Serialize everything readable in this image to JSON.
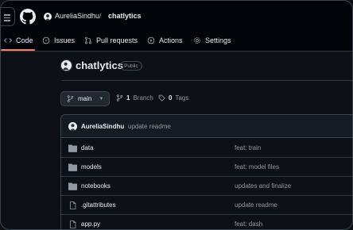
{
  "header": {
    "owner": "AureliaSindhu",
    "separator": "/",
    "repo": "chatlytics"
  },
  "tabs": [
    {
      "label": "Code",
      "icon": "code-icon",
      "active": true
    },
    {
      "label": "Issues",
      "icon": "issue-icon"
    },
    {
      "label": "Pull requests",
      "icon": "pull-request-icon"
    },
    {
      "label": "Actions",
      "icon": "play-icon"
    },
    {
      "label": "Settings",
      "icon": "gear-icon"
    }
  ],
  "repo": {
    "name": "chatlytics",
    "visibility": "Public"
  },
  "branch": {
    "current": "main",
    "branch_count": "1",
    "branch_label": "Branch",
    "tag_count": "0",
    "tag_label": "Tags"
  },
  "commit": {
    "author": "AureliaSindhu",
    "message": "update readme"
  },
  "files": [
    {
      "name": "data",
      "type": "folder",
      "message": "feat: train"
    },
    {
      "name": "models",
      "type": "folder",
      "message": "feat: model files"
    },
    {
      "name": "notebooks",
      "type": "folder",
      "message": "updates and finalize"
    },
    {
      "name": ".gitattributes",
      "type": "file",
      "message": "update readme"
    },
    {
      "name": "app.py",
      "type": "file",
      "message": "feat: dash"
    }
  ],
  "colors": {
    "background": "#0d1117",
    "header": "#010409",
    "active_tab_underline": "#f78166",
    "muted_text": "#9198a1",
    "folder_icon": "#9198a1"
  }
}
